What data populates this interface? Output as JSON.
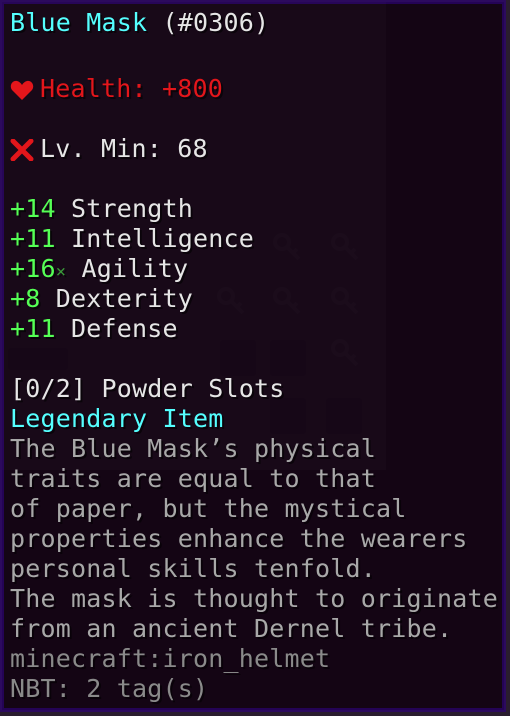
{
  "item": {
    "name": "Blue Mask",
    "id": "(#0306)",
    "health_label": "Health:",
    "health_value": "+800",
    "level_label": "Lv. Min:",
    "level_value": "68",
    "stats": [
      {
        "value": "+14",
        "name": "Strength"
      },
      {
        "value": "+11",
        "name": "Intelligence"
      },
      {
        "value": "+16",
        "suffix": "×",
        "name": "Agility"
      },
      {
        "value": "+8",
        "name": "Dexterity"
      },
      {
        "value": "+11",
        "name": "Defense"
      }
    ],
    "powder_slots": "[0/2] Powder Slots",
    "rarity": "Legendary Item",
    "lore": [
      "The Blue Mask’s physical",
      "traits are equal to that",
      "of paper, but the mystical",
      "properties enhance the wearers",
      "personal skills tenfold.",
      "The mask is thought to originate",
      "from an ancient Dernel tribe."
    ],
    "registry_name": "minecraft:iron_helmet",
    "nbt": "NBT: 2 tag(s)"
  },
  "colors": {
    "name": "#55ffff",
    "health": "#e3161b",
    "stat_value": "#55ff55",
    "lore": "#a8a8a8"
  },
  "icons": {
    "health": "heart-icon",
    "level": "cross-icon"
  }
}
